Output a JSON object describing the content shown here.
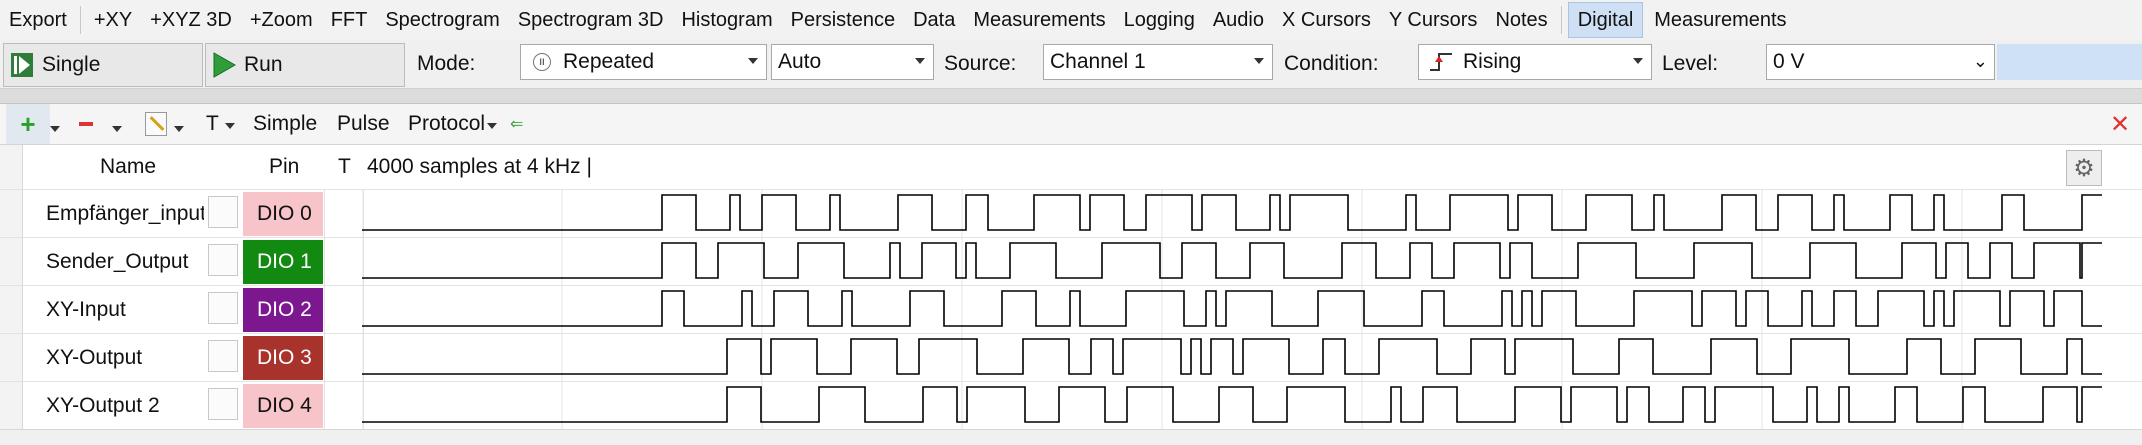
{
  "menu": {
    "items": [
      "Export",
      "+XY",
      "+XYZ 3D",
      "+Zoom",
      "FFT",
      "Spectrogram",
      "Spectrogram 3D",
      "Histogram",
      "Persistence",
      "Data",
      "Measurements",
      "Logging",
      "Audio",
      "X Cursors",
      "Y Cursors",
      "Notes",
      "Digital",
      "Measurements"
    ],
    "active_index": 16
  },
  "toolbar": {
    "single_label": "Single",
    "run_label": "Run",
    "mode_label": "Mode:",
    "mode_value": "Repeated",
    "auto_value": "Auto",
    "source_label": "Source:",
    "source_value": "Channel 1",
    "condition_label": "Condition:",
    "condition_value": "Rising",
    "level_label": "Level:",
    "level_value": "0 V"
  },
  "digital_toolbar": {
    "text_tool": "T",
    "simple_label": "Simple",
    "pulse_label": "Pulse",
    "protocol_label": "Protocol"
  },
  "table": {
    "col_name": "Name",
    "col_pin": "Pin",
    "col_t": "T",
    "status": "4000 samples at 4 kHz |",
    "rows": [
      {
        "name": "Empfänger_input",
        "pin": "DIO 0",
        "color": "#f6c4c9"
      },
      {
        "name": "Sender_Output",
        "pin": "DIO 1",
        "color": "#128a12"
      },
      {
        "name": "XY-Input",
        "pin": "DIO 2",
        "color": "#7d1790"
      },
      {
        "name": "XY-Output",
        "pin": "DIO 3",
        "color": "#a8322c"
      },
      {
        "name": "XY-Output 2",
        "pin": "DIO 4",
        "color": "#f6c4c9"
      }
    ]
  },
  "colors": {
    "accent": "#cfe0f5",
    "signal": "#000000"
  },
  "icons": [
    "single-icon",
    "run-icon",
    "repeat-icon",
    "rising-edge-icon",
    "add-icon",
    "remove-icon",
    "edit-icon",
    "arrow-icon",
    "close-icon",
    "gear-icon"
  ]
}
